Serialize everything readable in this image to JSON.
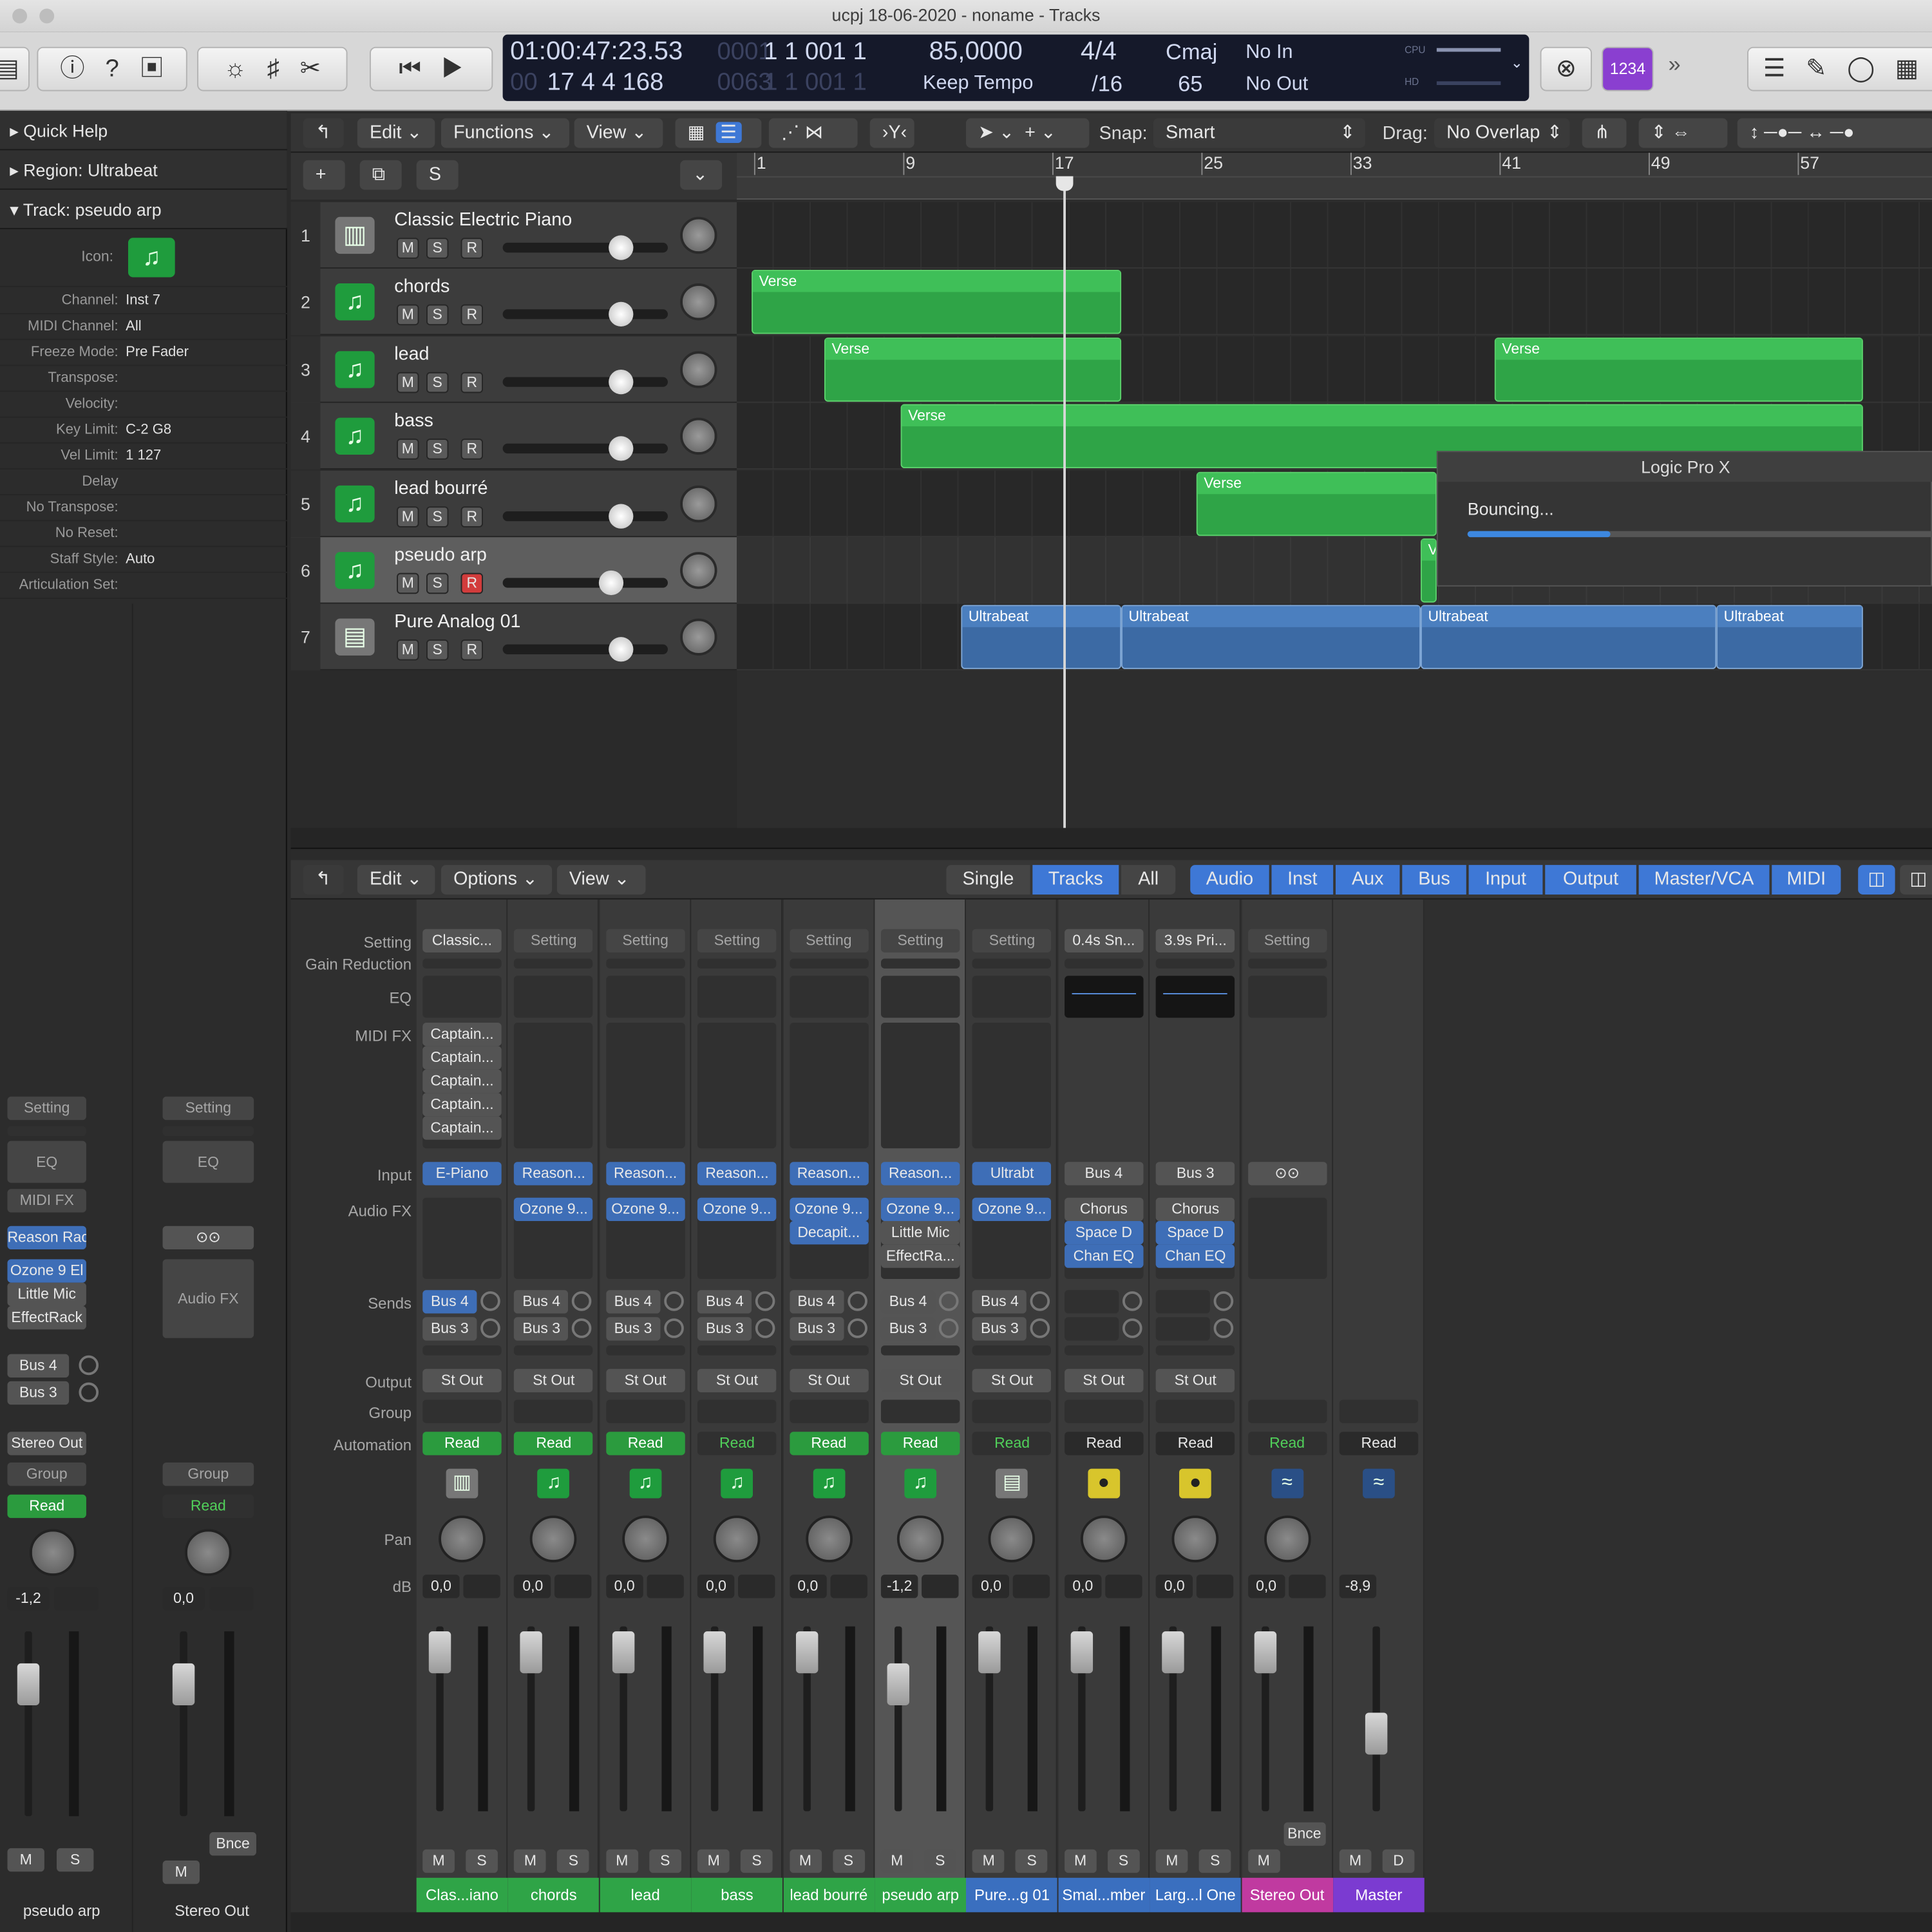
{
  "window": {
    "title": "ucpj 18-06-2020 - noname - Tracks"
  },
  "lcd": {
    "time": "01:00:47:23.53",
    "bars_dim": "0001",
    "bars": "1  1  001  1",
    "bars2": "17  4  4  168",
    "bars2_dim": "0063",
    "bars2b": "1  1  001  1",
    "tempo": "85,0000",
    "tempo_mode": "Keep Tempo",
    "sig_top": "4/4",
    "sig_bottom": "/16",
    "key": "Cmaj",
    "key_bottom": "65",
    "in": "No In",
    "out": "No Out",
    "cpu": "CPU",
    "hd": "HD"
  },
  "toolbar": {
    "count_in": "1234"
  },
  "inspector": {
    "quick_help": "Quick Help",
    "region": "Region: Ultrabeat",
    "track": "Track:  pseudo  arp",
    "icon_label": "Icon:",
    "rows": [
      {
        "k": "Channel:",
        "v": "Inst 7"
      },
      {
        "k": "MIDI Channel:",
        "v": "All"
      },
      {
        "k": "Freeze Mode:",
        "v": "Pre Fader"
      },
      {
        "k": "Transpose:",
        "v": ""
      },
      {
        "k": "Velocity:",
        "v": ""
      },
      {
        "k": "Key Limit:",
        "v": "C-2  G8"
      },
      {
        "k": "Vel Limit:",
        "v": "1  127"
      },
      {
        "k": "Delay",
        "v": ""
      },
      {
        "k": "No Transpose:",
        "v": ""
      },
      {
        "k": "No Reset:",
        "v": ""
      },
      {
        "k": "Staff Style:",
        "v": "Auto"
      },
      {
        "k": "Articulation Set:",
        "v": ""
      }
    ],
    "strip1": {
      "setting": "Setting",
      "eq": "EQ",
      "midifx": "MIDI FX",
      "input": "Reason Rac",
      "fx1": "Ozone 9 El",
      "fx2": "Little Mic",
      "fx3": "EffectRack",
      "send1": "Bus 4",
      "send2": "Bus 3",
      "output": "Stereo Out",
      "group": "Group",
      "auto": "Read",
      "db": "-1,2",
      "m": "M",
      "s": "S",
      "name": "pseudo  arp"
    },
    "strip2": {
      "setting": "Setting",
      "eq": "EQ",
      "audiofx": "Audio FX",
      "group": "Group",
      "auto": "Read",
      "db": "0,0",
      "bnce": "Bnce",
      "m": "M",
      "name": "Stereo Out"
    }
  },
  "tracks_menu": {
    "edit": "Edit",
    "functions": "Functions",
    "view": "View",
    "snap_label": "Snap:",
    "snap": "Smart",
    "drag_label": "Drag:",
    "drag": "No Overlap",
    "s": "S"
  },
  "ruler": [
    "1",
    "9",
    "17",
    "25",
    "33",
    "41",
    "49",
    "57"
  ],
  "tracks": [
    {
      "num": "1",
      "name": "Classic Electric Piano"
    },
    {
      "num": "2",
      "name": "chords"
    },
    {
      "num": "3",
      "name": "lead"
    },
    {
      "num": "4",
      "name": "bass"
    },
    {
      "num": "5",
      "name": "lead bourré"
    },
    {
      "num": "6",
      "name": "pseudo  arp"
    },
    {
      "num": "7",
      "name": "Pure Analog 01"
    }
  ],
  "track_buttons": {
    "m": "M",
    "s": "S",
    "r": "R"
  },
  "regions": {
    "verse": "Verse",
    "ultrabeat": "Ultrabeat",
    "ve": "Ve"
  },
  "dialog": {
    "title": "Logic Pro X",
    "text": "Bouncing...",
    "progress": 0.29
  },
  "mixer_menu": {
    "edit": "Edit",
    "options": "Options",
    "view": "View",
    "single": "Single",
    "tracks": "Tracks",
    "all": "All",
    "audio": "Audio",
    "inst": "Inst",
    "aux": "Aux",
    "bus": "Bus",
    "input": "Input",
    "output": "Output",
    "mastervca": "Master/VCA",
    "midi": "MIDI"
  },
  "mixer_labels": {
    "setting": "Setting",
    "gain": "Gain Reduction",
    "eq": "EQ",
    "midifx": "MIDI FX",
    "input": "Input",
    "audiofx": "Audio FX",
    "sends": "Sends",
    "output": "Output",
    "group": "Group",
    "automation": "Automation",
    "pan": "Pan",
    "db": "dB"
  },
  "channels": [
    {
      "setting": "Classic...",
      "input": "E-Piano",
      "fx": [],
      "midifx": [
        "Captain...",
        "Captain...",
        "Captain...",
        "Captain...",
        "Captain..."
      ],
      "sends": [
        "Bus 4",
        "Bus 3"
      ],
      "output": "St Out",
      "auto": "Read",
      "db": "0,0",
      "name": "Clas...iano",
      "color": "#2fa447"
    },
    {
      "setting": "Setting",
      "input": "Reason...",
      "fx": [
        "Ozone 9..."
      ],
      "midifx": [],
      "sends": [
        "Bus 4",
        "Bus 3"
      ],
      "output": "St Out",
      "auto": "Read",
      "db": "0,0",
      "name": "chords",
      "color": "#2fa447"
    },
    {
      "setting": "Setting",
      "input": "Reason...",
      "fx": [
        "Ozone 9..."
      ],
      "midifx": [],
      "sends": [
        "Bus 4",
        "Bus 3"
      ],
      "output": "St Out",
      "auto": "Read",
      "db": "0,0",
      "name": "lead",
      "color": "#2fa447"
    },
    {
      "setting": "Setting",
      "input": "Reason...",
      "fx": [
        "Ozone 9..."
      ],
      "midifx": [],
      "sends": [
        "Bus 4",
        "Bus 3"
      ],
      "output": "St Out",
      "auto": "Read",
      "db": "0,0",
      "name": "bass",
      "color": "#2fa447"
    },
    {
      "setting": "Setting",
      "input": "Reason...",
      "fx": [
        "Ozone 9...",
        "Decapit..."
      ],
      "midifx": [],
      "sends": [
        "Bus 4",
        "Bus 3"
      ],
      "output": "St Out",
      "auto": "Read",
      "db": "0,0",
      "name": "lead bourré",
      "color": "#2fa447"
    },
    {
      "setting": "Setting",
      "input": "Reason...",
      "fx": [
        "Ozone 9...",
        "Little Mic",
        "EffectRa..."
      ],
      "midifx": [],
      "sends": [
        "Bus 4",
        "Bus 3"
      ],
      "output": "St Out",
      "auto": "Read",
      "db": "-1,2",
      "name": "pseudo  arp",
      "color": "#2fa447"
    },
    {
      "setting": "Setting",
      "input": "Ultrabt",
      "fx": [
        "Ozone 9..."
      ],
      "midifx": [],
      "sends": [
        "Bus 4",
        "Bus 3"
      ],
      "output": "St Out",
      "auto": "Read",
      "db": "0,0",
      "name": "Pure...g 01",
      "color": "#3a6fbf"
    },
    {
      "setting": "0.4s Sn...",
      "input": "Bus 4",
      "fx": [
        "Chorus",
        "Space D",
        "Chan EQ"
      ],
      "midifx": [],
      "sends": [],
      "output": "St Out",
      "auto": "Read",
      "db": "0,0",
      "name": "Smal...mber",
      "color": "#3a6fbf"
    },
    {
      "setting": "3.9s Pri...",
      "input": "Bus 3",
      "fx": [
        "Chorus",
        "Space D",
        "Chan EQ"
      ],
      "midifx": [],
      "sends": [],
      "output": "St Out",
      "auto": "Read",
      "db": "0,0",
      "name": "Larg...l One",
      "color": "#3a6fbf"
    },
    {
      "setting": "Setting",
      "input": "",
      "fx": [],
      "midifx": [],
      "sends": [],
      "output": "",
      "auto": "Read",
      "db": "0,0",
      "name": "Stereo Out",
      "color": "#c03aa0",
      "bnce": "Bnce"
    },
    {
      "setting": "",
      "input": "",
      "fx": [],
      "midifx": [],
      "sends": [],
      "output": "",
      "auto": "Read",
      "db": "-8,9",
      "name": "Master",
      "color": "#7b3bd1"
    }
  ],
  "channel_buttons": {
    "m": "M",
    "s": "S",
    "d": "D"
  }
}
